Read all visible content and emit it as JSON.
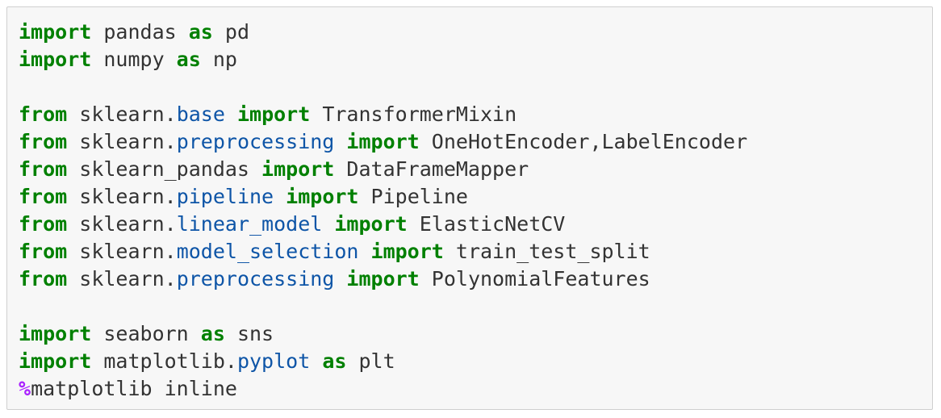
{
  "cell": {
    "language": "python",
    "lines": [
      [
        {
          "t": "kw",
          "v": "import"
        },
        {
          "t": "txt",
          "v": " pandas "
        },
        {
          "t": "kw",
          "v": "as"
        },
        {
          "t": "txt",
          "v": " pd"
        }
      ],
      [
        {
          "t": "kw",
          "v": "import"
        },
        {
          "t": "txt",
          "v": " numpy "
        },
        {
          "t": "kw",
          "v": "as"
        },
        {
          "t": "txt",
          "v": " np"
        }
      ],
      [],
      [
        {
          "t": "kw",
          "v": "from"
        },
        {
          "t": "txt",
          "v": " sklearn."
        },
        {
          "t": "mod",
          "v": "base"
        },
        {
          "t": "txt",
          "v": " "
        },
        {
          "t": "kw",
          "v": "import"
        },
        {
          "t": "txt",
          "v": " TransformerMixin"
        }
      ],
      [
        {
          "t": "kw",
          "v": "from"
        },
        {
          "t": "txt",
          "v": " sklearn."
        },
        {
          "t": "mod",
          "v": "preprocessing"
        },
        {
          "t": "txt",
          "v": " "
        },
        {
          "t": "kw",
          "v": "import"
        },
        {
          "t": "txt",
          "v": " OneHotEncoder,LabelEncoder"
        }
      ],
      [
        {
          "t": "kw",
          "v": "from"
        },
        {
          "t": "txt",
          "v": " sklearn_pandas "
        },
        {
          "t": "kw",
          "v": "import"
        },
        {
          "t": "txt",
          "v": " DataFrameMapper"
        }
      ],
      [
        {
          "t": "kw",
          "v": "from"
        },
        {
          "t": "txt",
          "v": " sklearn."
        },
        {
          "t": "mod",
          "v": "pipeline"
        },
        {
          "t": "txt",
          "v": " "
        },
        {
          "t": "kw",
          "v": "import"
        },
        {
          "t": "txt",
          "v": " Pipeline"
        }
      ],
      [
        {
          "t": "kw",
          "v": "from"
        },
        {
          "t": "txt",
          "v": " sklearn."
        },
        {
          "t": "mod",
          "v": "linear_model"
        },
        {
          "t": "txt",
          "v": " "
        },
        {
          "t": "kw",
          "v": "import"
        },
        {
          "t": "txt",
          "v": " ElasticNetCV"
        }
      ],
      [
        {
          "t": "kw",
          "v": "from"
        },
        {
          "t": "txt",
          "v": " sklearn."
        },
        {
          "t": "mod",
          "v": "model_selection"
        },
        {
          "t": "txt",
          "v": " "
        },
        {
          "t": "kw",
          "v": "import"
        },
        {
          "t": "txt",
          "v": " train_test_split"
        }
      ],
      [
        {
          "t": "kw",
          "v": "from"
        },
        {
          "t": "txt",
          "v": " sklearn."
        },
        {
          "t": "mod",
          "v": "preprocessing"
        },
        {
          "t": "txt",
          "v": " "
        },
        {
          "t": "kw",
          "v": "import"
        },
        {
          "t": "txt",
          "v": " PolynomialFeatures"
        }
      ],
      [],
      [
        {
          "t": "kw",
          "v": "import"
        },
        {
          "t": "txt",
          "v": " seaborn "
        },
        {
          "t": "kw",
          "v": "as"
        },
        {
          "t": "txt",
          "v": " sns"
        }
      ],
      [
        {
          "t": "kw",
          "v": "import"
        },
        {
          "t": "txt",
          "v": " matplotlib."
        },
        {
          "t": "mod",
          "v": "pyplot"
        },
        {
          "t": "txt",
          "v": " "
        },
        {
          "t": "kw",
          "v": "as"
        },
        {
          "t": "txt",
          "v": " plt"
        }
      ],
      [
        {
          "t": "magic",
          "v": "%"
        },
        {
          "t": "txt",
          "v": "matplotlib inline"
        }
      ]
    ]
  },
  "colors": {
    "background": "#f7f7f7",
    "border": "#cfcfcf",
    "keyword": "#008000",
    "module": "#0e55a7",
    "magic": "#aa22ff",
    "text": "#333333"
  }
}
